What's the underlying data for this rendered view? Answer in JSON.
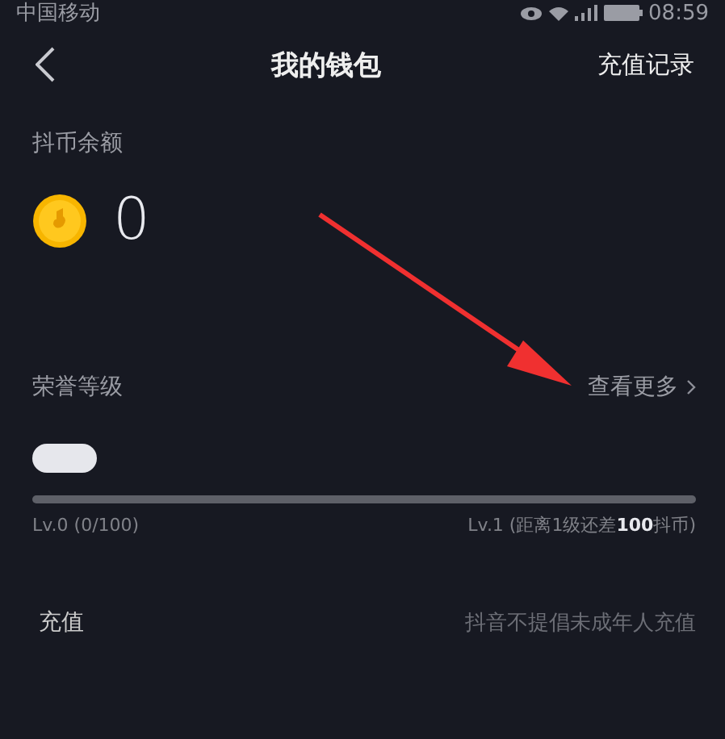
{
  "status_bar": {
    "carrier": "中国移动",
    "time": "08:59"
  },
  "nav": {
    "title": "我的钱包",
    "action": "充值记录"
  },
  "balance": {
    "label": "抖币余额",
    "value": "0"
  },
  "honor": {
    "title": "荣誉等级",
    "more": "查看更多",
    "level": 0,
    "current": "Lv.0 (0/100)",
    "next": "Lv.1 (距离1级还差**100**抖币)"
  },
  "recharge": {
    "label": "充值",
    "note": "抖音不提倡未成年人充值"
  }
}
